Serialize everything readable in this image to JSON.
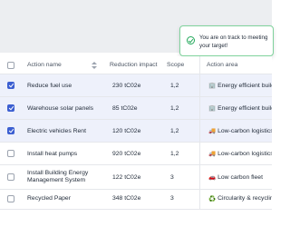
{
  "toast": {
    "message": "You are on track to meeting your target!",
    "icon": "check-circle-icon",
    "accent": "#22a85a"
  },
  "table": {
    "columns": {
      "action_name": "Action name",
      "reduction_impact": "Reduction impact",
      "scope": "Scope",
      "action_area": "Action area"
    },
    "rows": [
      {
        "checked": true,
        "name": "Reduce fuel use",
        "reduction": "230 tC02e",
        "scope": "1,2",
        "area_icon": "🏢",
        "area": "Energy efficient building"
      },
      {
        "checked": true,
        "name": "Warehouse solar panels",
        "reduction": "85 tC02e",
        "scope": "1,2",
        "area_icon": "🏢",
        "area": "Energy efficient building"
      },
      {
        "checked": true,
        "name": "Electric vehicles Rent",
        "reduction": "120 tC02e",
        "scope": "1,2",
        "area_icon": "🚚",
        "area": "Low-carbon logistics"
      },
      {
        "checked": false,
        "name": "Install heat pumps",
        "reduction": "920 tC02e",
        "scope": "1,2",
        "area_icon": "🚚",
        "area": "Low-carbon logistics"
      },
      {
        "checked": false,
        "name": "Install Building Energy Management System",
        "reduction": "122 tC02e",
        "scope": "3",
        "area_icon": "🚗",
        "area": "Low carbon fleet"
      },
      {
        "checked": false,
        "name": "Recycled Paper",
        "reduction": "348 tC02e",
        "scope": "3",
        "area_icon": "♻️",
        "area": "Circularity & recycling"
      }
    ]
  },
  "colors": {
    "accent": "#3c5fd1",
    "selected_row": "#eef1fb",
    "header_band": "#eceef1"
  }
}
